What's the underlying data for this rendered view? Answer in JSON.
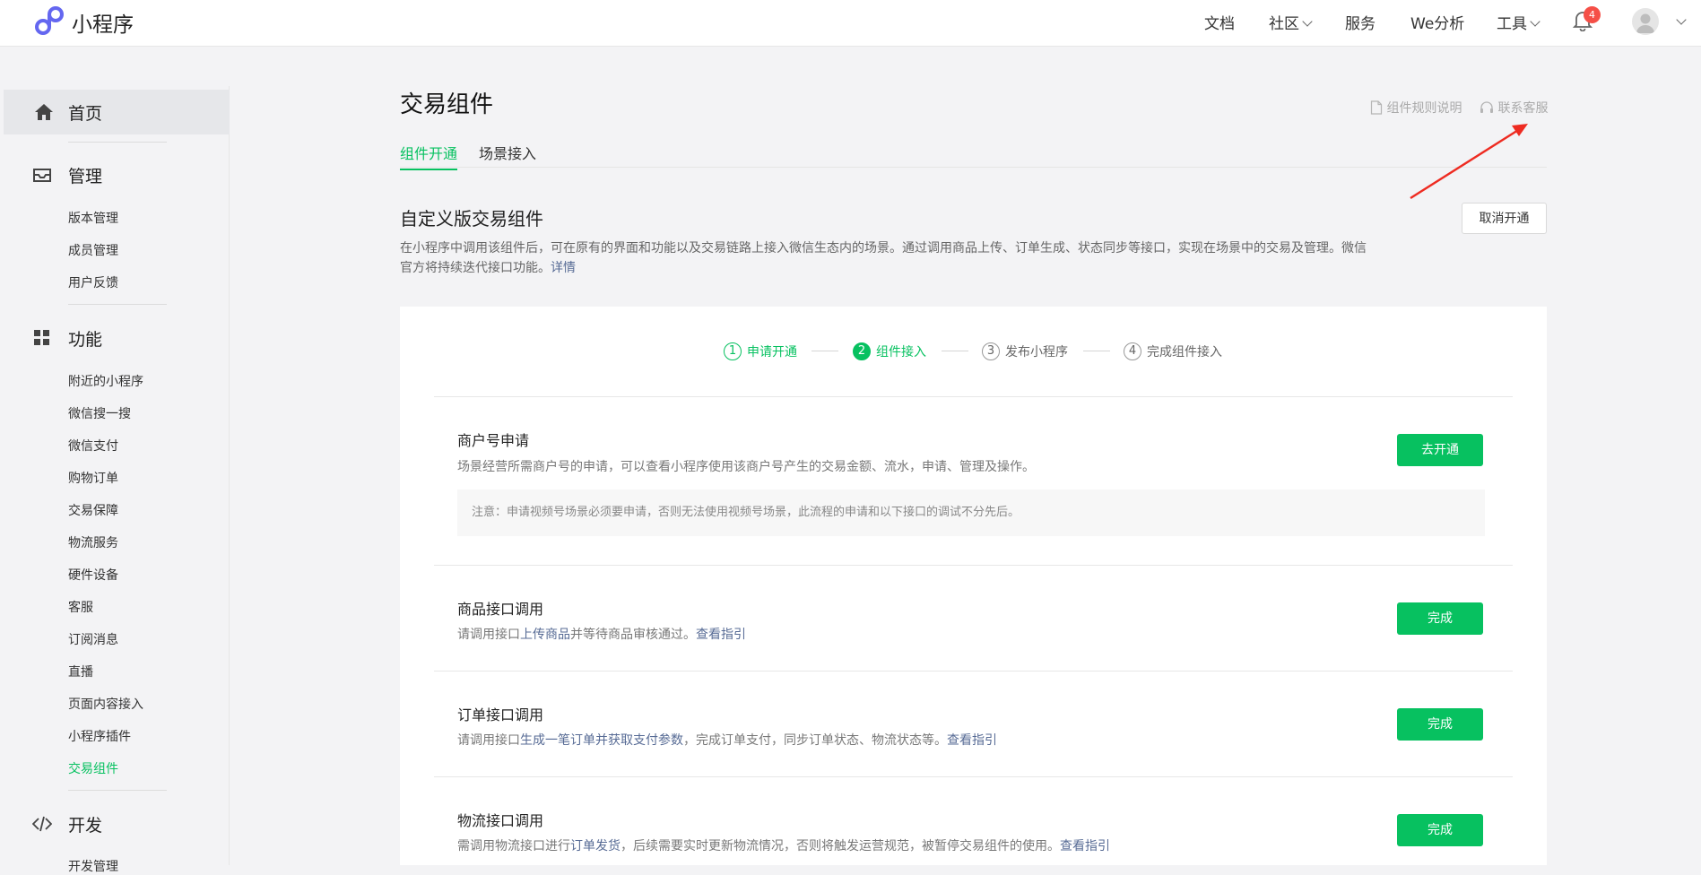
{
  "header": {
    "brand": "小程序",
    "nav": {
      "docs": "文档",
      "community": "社区",
      "services": "服务",
      "analytics": "We分析",
      "tools": "工具"
    },
    "notification_count": "4"
  },
  "sidebar": {
    "home": "首页",
    "manage": {
      "label": "管理",
      "items": [
        "版本管理",
        "成员管理",
        "用户反馈"
      ]
    },
    "features": {
      "label": "功能",
      "items": [
        "附近的小程序",
        "微信搜一搜",
        "微信支付",
        "购物订单",
        "交易保障",
        "物流服务",
        "硬件设备",
        "客服",
        "订阅消息",
        "直播",
        "页面内容接入",
        "小程序插件",
        "交易组件"
      ],
      "active": "交易组件"
    },
    "develop": {
      "label": "开发",
      "items": [
        "开发管理"
      ]
    }
  },
  "main": {
    "title": "交易组件",
    "rules_link": "组件规则说明",
    "contact_link": "联系客服",
    "tabs": [
      "组件开通",
      "场景接入"
    ],
    "section_title": "自定义版交易组件",
    "cancel_button": "取消开通",
    "description": "在小程序中调用该组件后，可在原有的界面和功能以及交易链路上接入微信生态内的场景。通过调用商品上传、订单生成、状态同步等接口，实现在场景中的交易及管理。微信官方将持续迭代接口功能。",
    "details_link": "详情",
    "steps": [
      {
        "num": "1",
        "label": "申请开通"
      },
      {
        "num": "2",
        "label": "组件接入"
      },
      {
        "num": "3",
        "label": "发布小程序"
      },
      {
        "num": "4",
        "label": "完成组件接入"
      }
    ],
    "rows": {
      "merchant": {
        "title": "商户号申请",
        "desc": "场景经营所需商户号的申请，可以查看小程序使用该商户号产生的交易金额、流水，申请、管理及操作。",
        "button": "去开通",
        "notice": "注意：申请视频号场景必须要申请，否则无法使用视频号场景，此流程的申请和以下接口的调试不分先后。"
      },
      "product": {
        "title": "商品接口调用",
        "desc_pre": "请调用接口",
        "desc_link": "上传商品",
        "desc_post": "并等待商品审核通过。",
        "guide": "查看指引",
        "button": "完成"
      },
      "order": {
        "title": "订单接口调用",
        "desc_pre": "请调用接口",
        "desc_link": "生成一笔订单并获取支付参数",
        "desc_post": "，完成订单支付，同步订单状态、物流状态等。",
        "guide": "查看指引",
        "button": "完成"
      },
      "logistics": {
        "title": "物流接口调用",
        "desc_pre": "需调用物流接口进行",
        "desc_link": "订单发货",
        "desc_post": "，后续需要实时更新物流情况，否则将触发运营规范，被暂停交易组件的使用。",
        "guide": "查看指引",
        "button": "完成"
      }
    }
  },
  "colors": {
    "accent": "#07c160",
    "link": "#576b95",
    "badge": "#f54f47",
    "annotation_arrow": "#ee2b21"
  }
}
